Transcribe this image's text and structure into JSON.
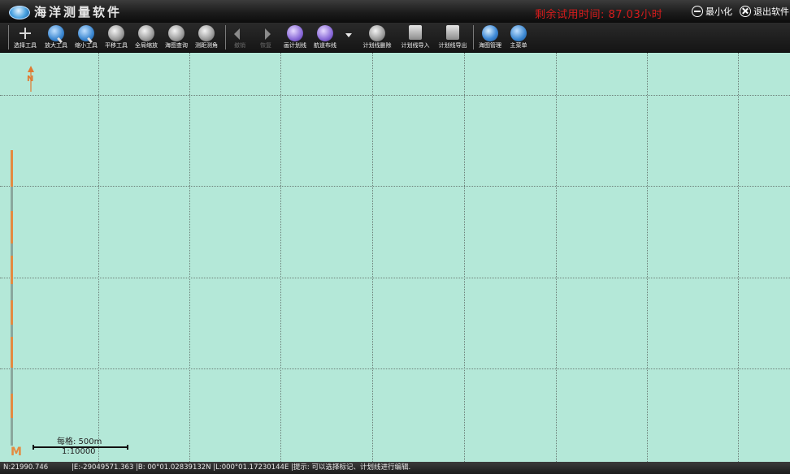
{
  "window": {
    "title": "海洋测量软件",
    "trial_text": "剩余试用时间: 87.03小时",
    "minimize_label": "最小化",
    "exit_label": "退出软件"
  },
  "toolbar": {
    "items": [
      {
        "label": "选择工具",
        "icon": "crosshair-icon",
        "enabled": true
      },
      {
        "label": "放大工具",
        "icon": "zoom-in-icon",
        "enabled": true
      },
      {
        "label": "缩小工具",
        "icon": "zoom-out-icon",
        "enabled": true
      },
      {
        "label": "平移工具",
        "icon": "hand-pan-icon",
        "enabled": true
      },
      {
        "label": "全局缩放",
        "icon": "fit-all-icon",
        "enabled": true
      },
      {
        "label": "海图查询",
        "icon": "query-pointer-icon",
        "enabled": true
      },
      {
        "label": "测距测角",
        "icon": "measure-ruler-icon",
        "enabled": true
      },
      {
        "label": "撤销",
        "icon": "undo-arrow-icon",
        "enabled": false
      },
      {
        "label": "恢复",
        "icon": "redo-arrow-icon",
        "enabled": false
      },
      {
        "label": "画计划线",
        "icon": "draw-plan-line-icon",
        "enabled": true
      },
      {
        "label": "航道布线",
        "icon": "channel-layout-icon",
        "enabled": true
      },
      {
        "label": "",
        "icon": "dropdown-caret-icon",
        "enabled": true
      },
      {
        "label": "计划线删除",
        "icon": "delete-plan-line-icon",
        "enabled": true
      },
      {
        "label": "计划线导入",
        "icon": "import-plan-line-icon",
        "enabled": true
      },
      {
        "label": "计划线导出",
        "icon": "export-plan-line-icon",
        "enabled": true
      },
      {
        "label": "海图管理",
        "icon": "globe-icon",
        "enabled": true
      },
      {
        "label": "主菜单",
        "icon": "main-menu-return-icon",
        "enabled": true
      }
    ]
  },
  "map": {
    "north_label": "N",
    "scale_grid_label": "每格: 500m",
    "scale_ratio": "1:10000",
    "corner_mark": "M",
    "background_color": "#b4e8d8",
    "accent_color": "#e07a30"
  },
  "status": {
    "northing": "N:21990.746",
    "rest": "|E:-29049571.363 |B: 00°01.02839132N |L:000°01.17230144E |提示: 可以选择标记、计划线进行编辑."
  }
}
